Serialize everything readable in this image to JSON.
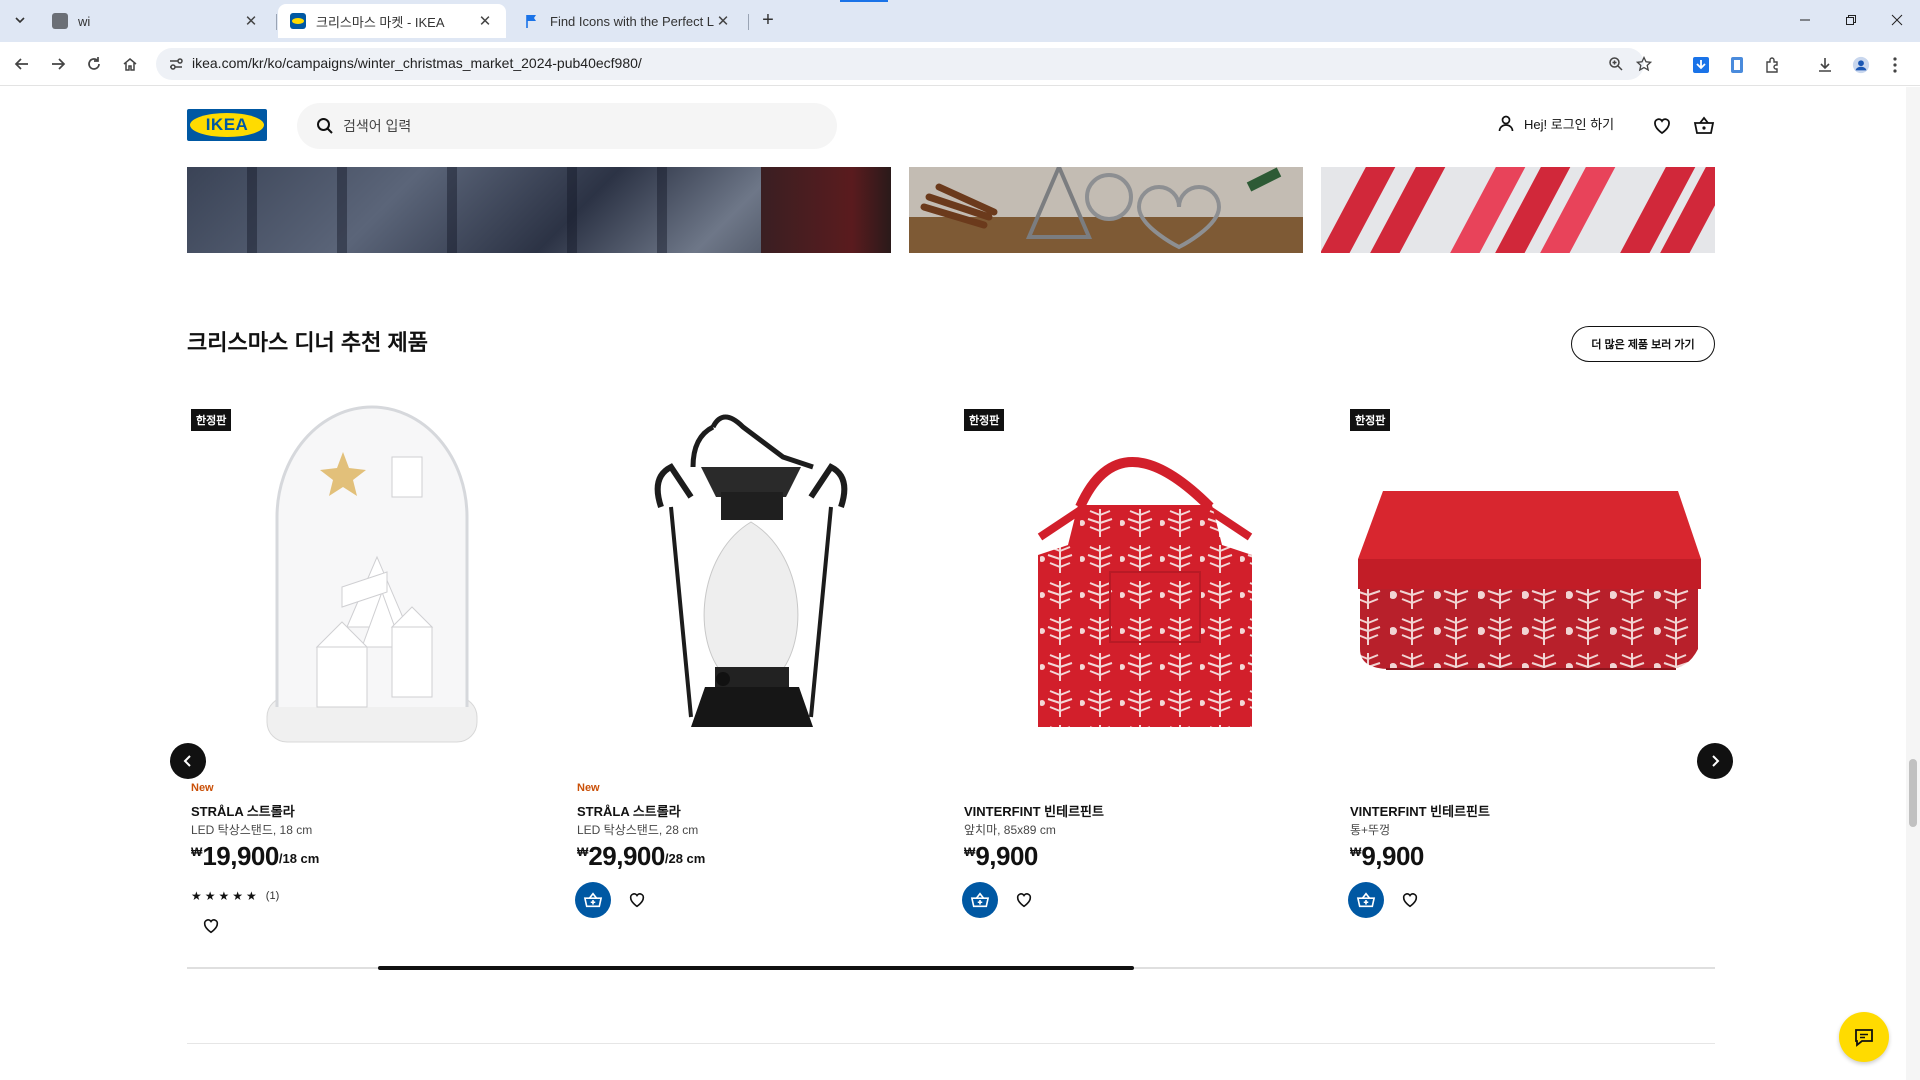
{
  "browser": {
    "tabs": [
      {
        "title": "wi",
        "active": false
      },
      {
        "title": "크리스마스 마켓 - IKEA",
        "active": true
      },
      {
        "title": "Find Icons with the Perfect Lo",
        "active": false
      }
    ],
    "url": "ikea.com/kr/ko/campaigns/winter_christmas_market_2024-pub40ecf980/"
  },
  "header": {
    "logo_text": "IKEA",
    "search_placeholder": "검색어 입력",
    "login_label": "Hej! 로그인 하기"
  },
  "section": {
    "title": "크리스마스 디너 추천 제품",
    "more_button": "더 많은 제품 보러 가기"
  },
  "products": [
    {
      "badge": "한정판",
      "new_label": "New",
      "name": "STRÅLA 스트롤라",
      "desc": "LED 탁상스탠드, 18 cm",
      "currency": "₩",
      "price": "19,900",
      "unit": "/18 cm",
      "stars": "★★★★★",
      "rating_count": "(1)"
    },
    {
      "badge": "",
      "new_label": "New",
      "name": "STRÅLA 스트롤라",
      "desc": "LED 탁상스탠드, 28 cm",
      "currency": "₩",
      "price": "29,900",
      "unit": "/28 cm"
    },
    {
      "badge": "한정판",
      "new_label": "",
      "name": "VINTERFINT 빈테르핀트",
      "desc": "앞치마, 85x89 cm",
      "currency": "₩",
      "price": "9,900",
      "unit": ""
    },
    {
      "badge": "한정판",
      "new_label": "",
      "name": "VINTERFINT 빈테르핀트",
      "desc": "통+뚜껑",
      "currency": "₩",
      "price": "9,900",
      "unit": ""
    }
  ],
  "carousel_progress": {
    "start": 0.125,
    "end": 0.62
  },
  "colors": {
    "ikea_blue": "#0058a3",
    "ikea_yellow": "#ffdb00",
    "new_orange": "#ca5008"
  }
}
